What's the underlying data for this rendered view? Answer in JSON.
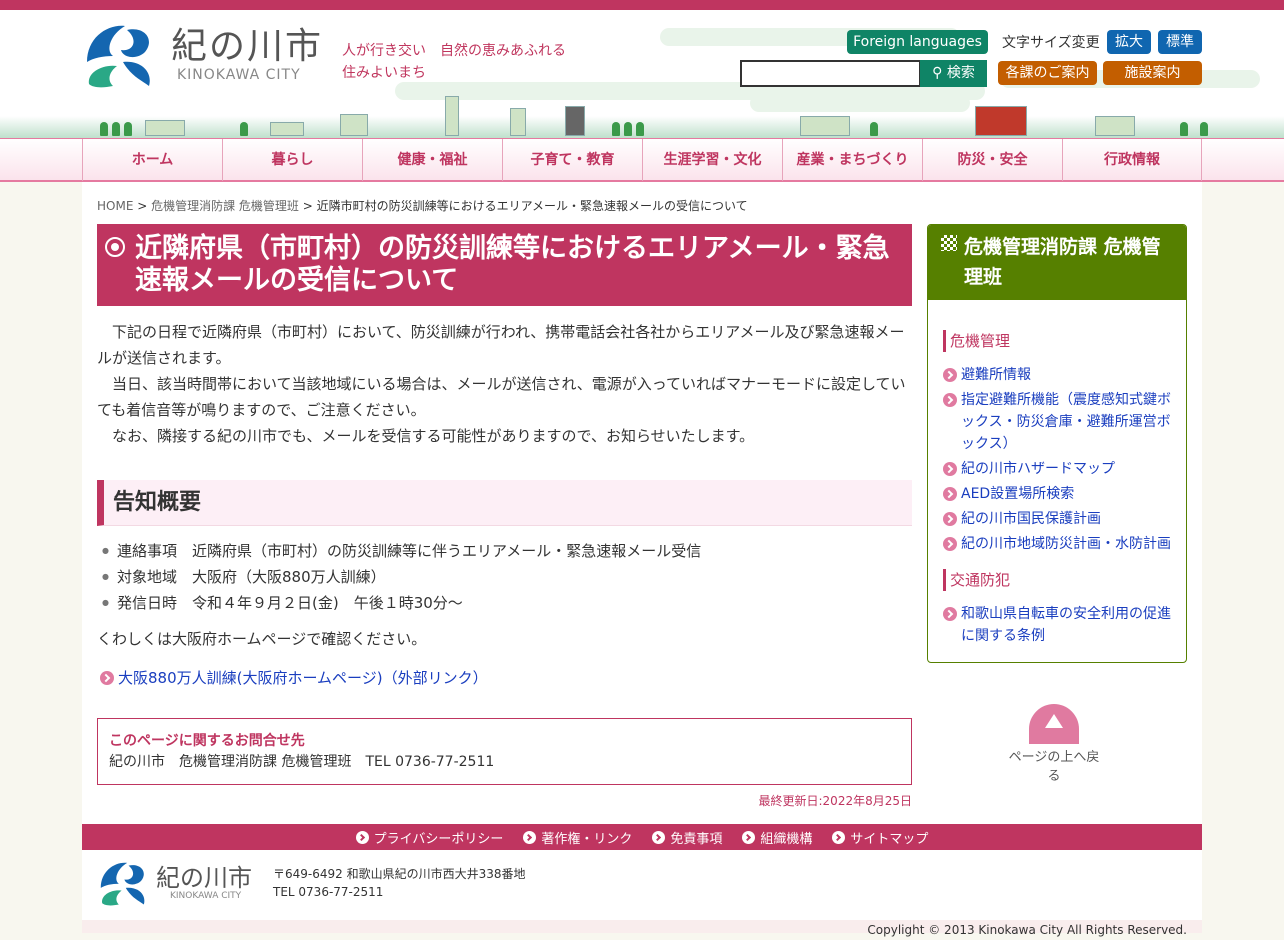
{
  "header": {
    "logo_jp": "紀の川市",
    "logo_en": "KINOKAWA CITY",
    "tagline1": "人が行き交い　自然の恵みあふれる",
    "tagline2": "住みよいまち",
    "foreign": "Foreign languages",
    "font_size_label": "文字サイズ変更",
    "enlarge": "拡大",
    "standard": "標準",
    "search_value": "",
    "search_button": "検索",
    "departments": "各課のご案内",
    "facilities": "施設案内"
  },
  "nav": [
    "ホーム",
    "暮らし",
    "健康・福祉",
    "子育て・教育",
    "生涯学習・文化",
    "産業・まちづくり",
    "防災・安全",
    "行政情報"
  ],
  "breadcrumb": {
    "home": "HOME",
    "section": "危機管理消防課 危機管理班",
    "current": "近隣市町村の防災訓練等におけるエリアメール・緊急速報メールの受信について"
  },
  "main": {
    "title": "近隣府県（市町村）の防災訓練等におけるエリアメール・緊急速報メールの受信について",
    "paragraphs": [
      "下記の日程で近隣府県（市町村）において、防災訓練が行われ、携帯電話会社各社からエリアメール及び緊急速報メールが送信されます。",
      "当日、該当時間帯において当該地域にいる場合は、メールが送信され、電源が入っていればマナーモードに設定していても着信音等が鳴りますので、ご注意ください。",
      "なお、隣接する紀の川市でも、メールを受信する可能性がありますので、お知らせいたします。"
    ],
    "section_heading": "告知概要",
    "items": [
      "連絡事項　近隣府県（市町村）の防災訓練等に伴うエリアメール・緊急速報メール受信",
      "対象地域　大阪府（大阪880万人訓練）",
      "発信日時　令和４年９月２日(金)　午後１時30分～"
    ],
    "note": "くわしくは大阪府ホームページで確認ください。",
    "link": "大阪880万人訓練(大阪府ホームページ)（外部リンク）",
    "contact_title": "このページに関するお問合せ先",
    "contact_body": "紀の川市　危機管理消防課 危機管理班　TEL 0736-77-2511",
    "updated": "最終更新日:2022年8月25日"
  },
  "sidebar": {
    "title": "危機管理消防課 危機管理班",
    "categories": [
      {
        "name": "危機管理",
        "links": [
          "避難所情報",
          "指定避難所機能（震度感知式鍵ボックス・防災倉庫・避難所運営ボックス）",
          "紀の川市ハザードマップ",
          "AED設置場所検索",
          "紀の川市国民保護計画",
          "紀の川市地域防災計画・水防計画"
        ]
      },
      {
        "name": "交通防犯",
        "links": [
          "和歌山県自転車の安全利用の促進に関する条例"
        ]
      }
    ]
  },
  "pagetop": "ページの上へ戻る",
  "footer": {
    "links": [
      "プライバシーポリシー",
      "著作権・リンク",
      "免責事項",
      "組織機構",
      "サイトマップ"
    ],
    "address": "〒649-6492 和歌山県紀の川市西大井338番地",
    "tel": "TEL 0736-77-2511",
    "copyright": "Copylight © 2013 Kinokawa City All Rights Reserved."
  },
  "colors": {
    "brand": "#bf3560",
    "green": "#0f8466",
    "blue": "#1066b0",
    "orange": "#c35e00",
    "side": "#568000"
  }
}
